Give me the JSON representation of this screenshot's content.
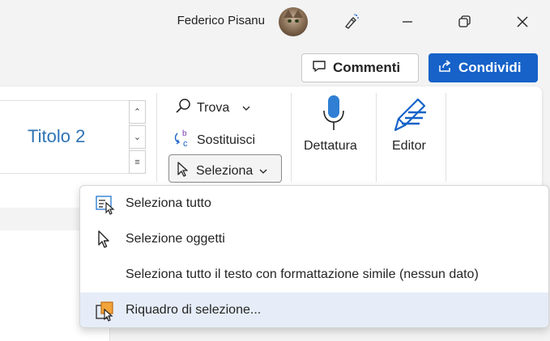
{
  "titlebar": {
    "user_name": "Federico Pisanu",
    "icons": [
      "avatar",
      "designer-icon",
      "minimize-icon",
      "restore-icon",
      "close-icon"
    ]
  },
  "commands": {
    "comments_label": "Commenti",
    "share_label": "Condividi"
  },
  "styles": {
    "current_style": "Titolo 2"
  },
  "editing": {
    "find_label": "Trova",
    "replace_label": "Sostituisci",
    "select_label": "Seleziona"
  },
  "voice": {
    "dictate_label": "Dettatura"
  },
  "editor": {
    "editor_label": "Editor"
  },
  "select_menu": {
    "items": [
      {
        "label": "Seleziona tutto",
        "icon": "select-all-icon"
      },
      {
        "label": "Selezione oggetti",
        "icon": "select-objects-icon"
      },
      {
        "label": "Seleziona tutto il testo con formattazione simile (nessun dato)",
        "icon": ""
      },
      {
        "label": "Riquadro di selezione...",
        "icon": "selection-pane-icon"
      }
    ],
    "hovered_index": 3
  },
  "colors": {
    "accent": "#1662c8",
    "heading_blue": "#2e74b5",
    "menu_hover": "#e6edf8"
  }
}
